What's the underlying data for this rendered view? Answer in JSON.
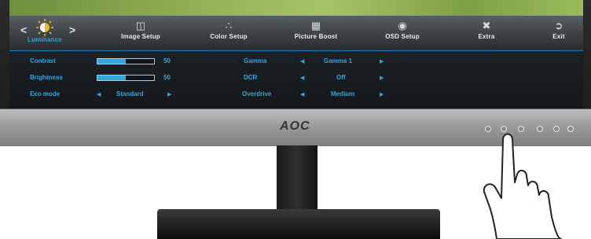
{
  "menu": {
    "items": [
      {
        "label": "Luminance",
        "icon": "sun-icon"
      },
      {
        "label": "Image Setup",
        "icon": "image-setup-icon"
      },
      {
        "label": "Color Setup",
        "icon": "color-setup-icon"
      },
      {
        "label": "Picture Boost",
        "icon": "picture-boost-icon"
      },
      {
        "label": "OSD Setup",
        "icon": "osd-setup-icon"
      },
      {
        "label": "Extra",
        "icon": "extra-icon"
      },
      {
        "label": "Exit",
        "icon": "exit-icon"
      }
    ]
  },
  "luminance": {
    "contrast": {
      "label": "Contrast",
      "value": "50",
      "level": 0.5
    },
    "brightness": {
      "label": "Brightness",
      "value": "50",
      "level": 0.5
    },
    "eco_mode": {
      "label": "Eco mode",
      "value": "Standard"
    },
    "gamma": {
      "label": "Gamma",
      "value": "Gamma 1"
    },
    "dcr": {
      "label": "DCR",
      "value": "Off"
    },
    "overdrive": {
      "label": "Overdrive",
      "value": "Medium"
    }
  },
  "brand": {
    "logo_text": "AOC"
  },
  "colors": {
    "accent": "#2ea7e0",
    "bezel": "#9b9b9b"
  }
}
